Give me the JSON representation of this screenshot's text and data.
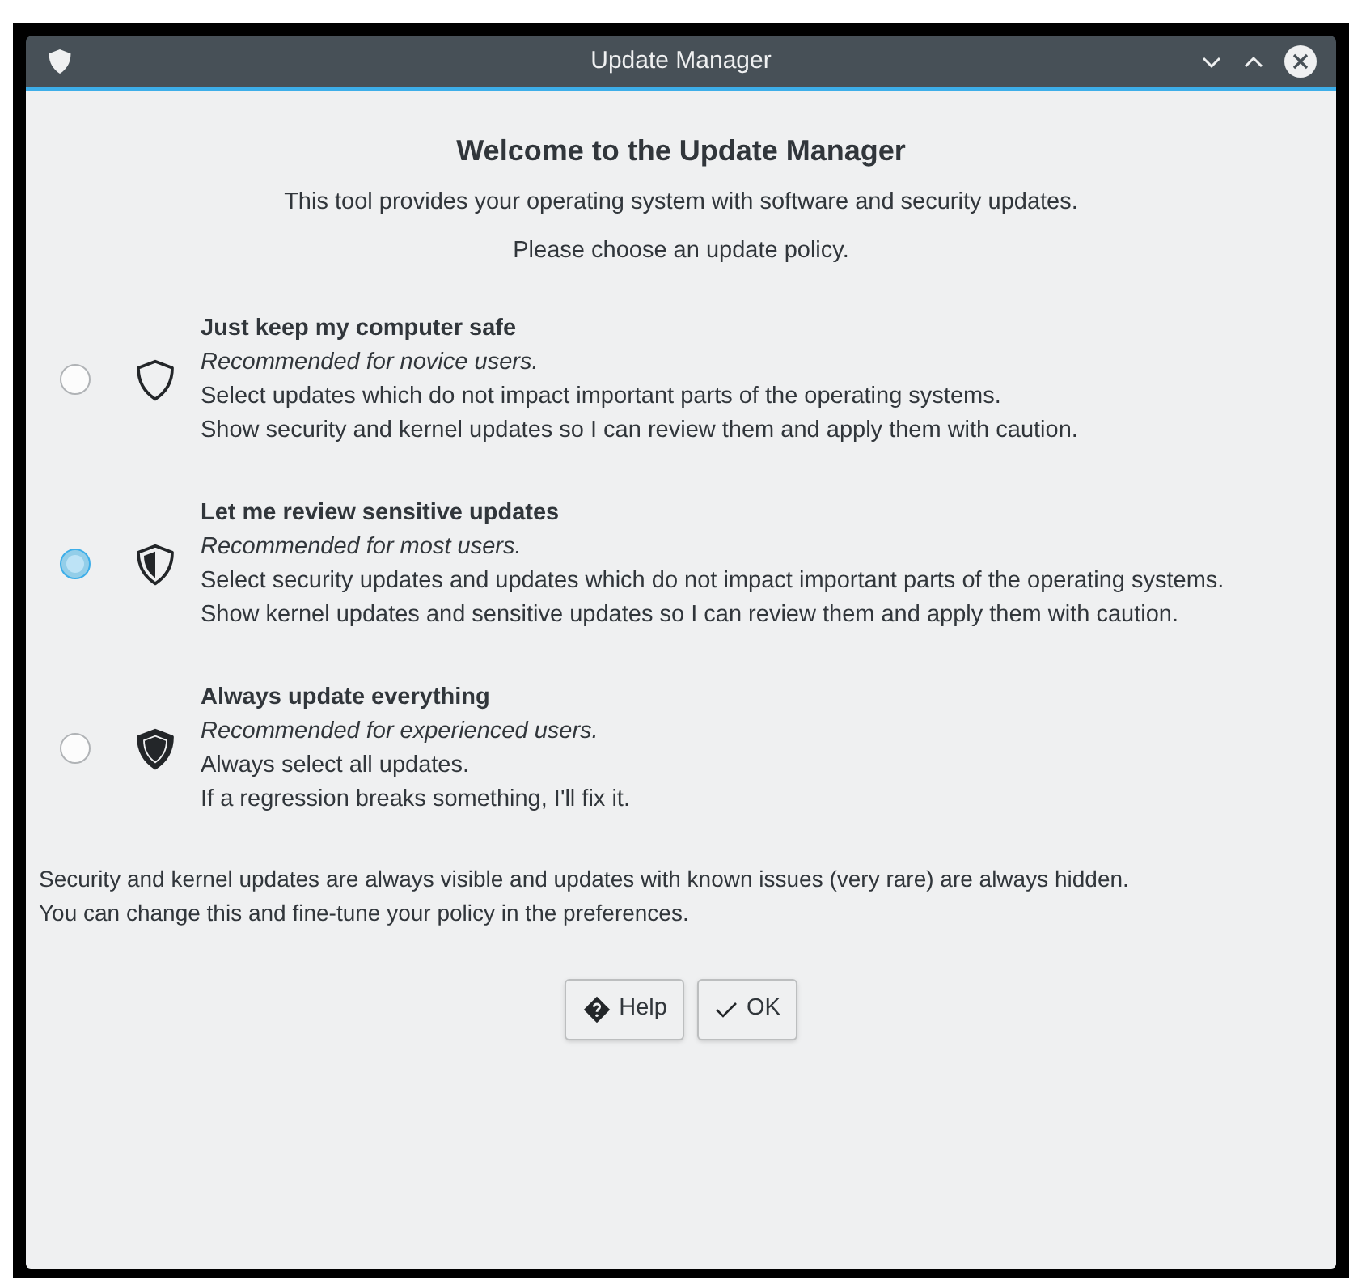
{
  "window": {
    "title": "Update Manager"
  },
  "heading": "Welcome to the Update Manager",
  "intro": [
    "This tool provides your operating system with software and security updates.",
    "Please choose an update policy."
  ],
  "policies": [
    {
      "title": "Just keep my computer safe",
      "subtitle": "Recommended for novice users.",
      "lines": [
        "Select updates which do not impact important parts of the operating systems.",
        "Show security and kernel updates so I can review them and apply them with caution."
      ],
      "kind": "outline",
      "selected": false
    },
    {
      "title": "Let me review sensitive updates",
      "subtitle": "Recommended for most users.",
      "lines": [
        "Select security updates and updates which do not impact important parts of the operating systems.",
        "Show kernel updates and sensitive updates so I can review them and apply them with caution."
      ],
      "kind": "half",
      "selected": true
    },
    {
      "title": "Always update everything",
      "subtitle": "Recommended for experienced users.",
      "lines": [
        "Always select all updates.",
        "If a regression breaks something, I'll fix it."
      ],
      "kind": "full",
      "selected": false
    }
  ],
  "footer": [
    "Security and kernel updates are always visible and updates with known issues (very rare) are always hidden.",
    "You can change this and fine-tune your policy in the preferences."
  ],
  "buttons": [
    {
      "label": "Help",
      "kind": "help"
    },
    {
      "label": "OK",
      "kind": "ok"
    }
  ]
}
